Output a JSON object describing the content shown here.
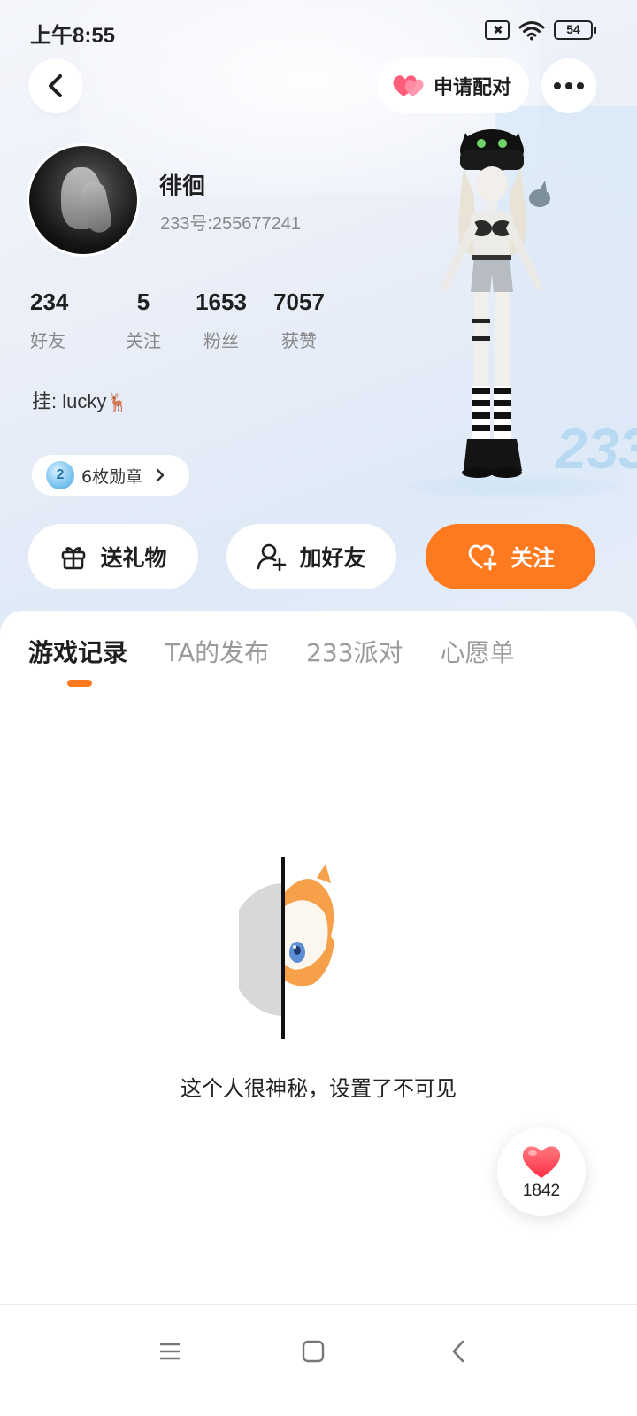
{
  "status_bar": {
    "time": "上午8:55",
    "battery": "54"
  },
  "header": {
    "pair_label": "申请配对"
  },
  "profile": {
    "nickname": "徘徊",
    "uid": "233号:255677241",
    "signature_prefix": "挂: lucky",
    "signature_emoji": "🦌",
    "stats": [
      {
        "value": "234",
        "label": "好友"
      },
      {
        "value": "5",
        "label": "关注"
      },
      {
        "value": "1653",
        "label": "粉丝"
      },
      {
        "value": "7057",
        "label": "获赞"
      }
    ],
    "badge": {
      "medal_number": "2",
      "label": "6枚勋章"
    }
  },
  "actions": {
    "gift": "送礼物",
    "add_friend": "加好友",
    "follow": "关注"
  },
  "tabs": [
    "游戏记录",
    "TA的发布",
    "233派对",
    "心愿单"
  ],
  "active_tab": "游戏记录",
  "empty_state": {
    "message": "这个人很神秘，设置了不可见"
  },
  "like_fab": {
    "count": "1842"
  },
  "stage_logo": "233",
  "colors": {
    "accent": "#ff7a1f",
    "heart": "#ff4d5e"
  },
  "icons": [
    "back-arrow-icon",
    "heart-pair-icon",
    "more-icon",
    "gift-icon",
    "add-user-icon",
    "heart-plus-icon",
    "like-heart-icon",
    "menu-icon",
    "home-square-icon",
    "back-chevron-icon"
  ]
}
